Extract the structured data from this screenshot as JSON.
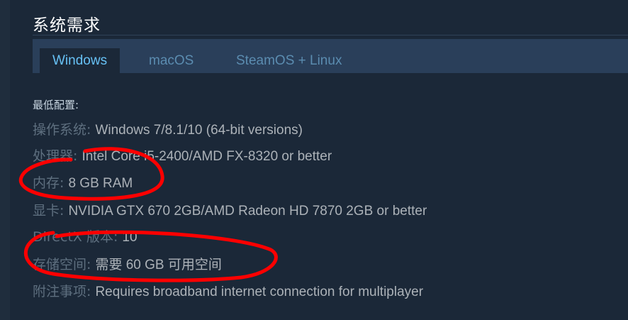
{
  "section_title": "系统需求",
  "tabs": [
    {
      "label": "Windows",
      "active": true
    },
    {
      "label": "macOS",
      "active": false
    },
    {
      "label": "SteamOS + Linux",
      "active": false
    }
  ],
  "minimum": {
    "heading": "最低配置:",
    "rows": [
      {
        "label": "操作系统:",
        "value": "Windows 7/8.1/10 (64-bit versions)"
      },
      {
        "label": "处理器:",
        "value": "Intel Core i5-2400/AMD FX-8320 or better"
      },
      {
        "label": "内存:",
        "value": "8 GB RAM"
      },
      {
        "label": "显卡:",
        "value": "NVIDIA GTX 670 2GB/AMD Radeon HD 7870 2GB or better"
      },
      {
        "label": "DirectX 版本:",
        "value": "10"
      },
      {
        "label": "存储空间:",
        "value": "需要 60 GB 可用空间"
      },
      {
        "label": "附注事项:",
        "value": "Requires broadband internet connection for multiplayer"
      }
    ]
  },
  "colors": {
    "background": "#1b2838",
    "tab_bar": "#2a3f5a",
    "active_tab_text": "#67c1f5",
    "annotation_red": "#ff0000"
  }
}
